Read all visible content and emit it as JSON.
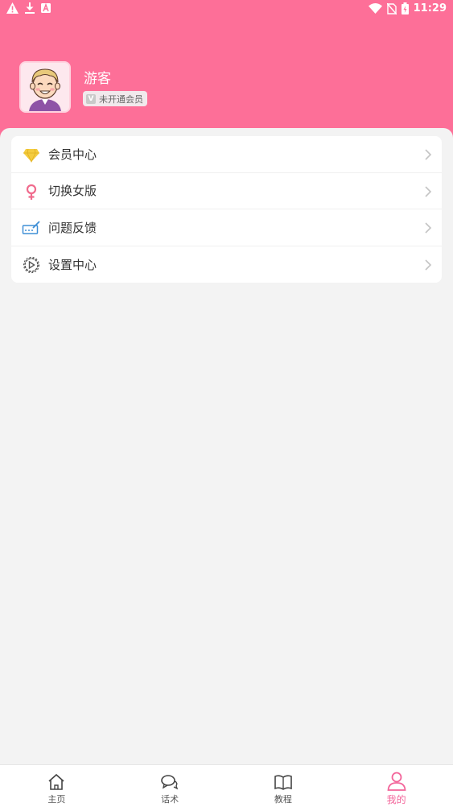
{
  "status_bar": {
    "time": "11:29",
    "icons": [
      "warning-icon",
      "download-icon",
      "a-icon",
      "wifi-icon",
      "no-sim-icon",
      "battery-icon"
    ]
  },
  "profile": {
    "username": "游客",
    "vip_badge_letter": "V",
    "vip_status": "未开通会员"
  },
  "menu": [
    {
      "label": "会员中心",
      "icon": "diamond-icon",
      "color": "#f4c93b"
    },
    {
      "label": "切换女版",
      "icon": "female-icon",
      "color": "#f06b8d"
    },
    {
      "label": "问题反馈",
      "icon": "feedback-icon",
      "color": "#3f8fd6"
    },
    {
      "label": "设置中心",
      "icon": "settings-icon",
      "color": "#555555"
    }
  ],
  "tabs": [
    {
      "label": "主页",
      "icon": "home-icon",
      "active": false
    },
    {
      "label": "话术",
      "icon": "chat-icon",
      "active": false
    },
    {
      "label": "教程",
      "icon": "book-icon",
      "active": false
    },
    {
      "label": "我的",
      "icon": "user-icon",
      "active": true
    }
  ],
  "colors": {
    "header": "#fd6f98",
    "accent": "#f3659a",
    "background": "#f3f3f3"
  }
}
